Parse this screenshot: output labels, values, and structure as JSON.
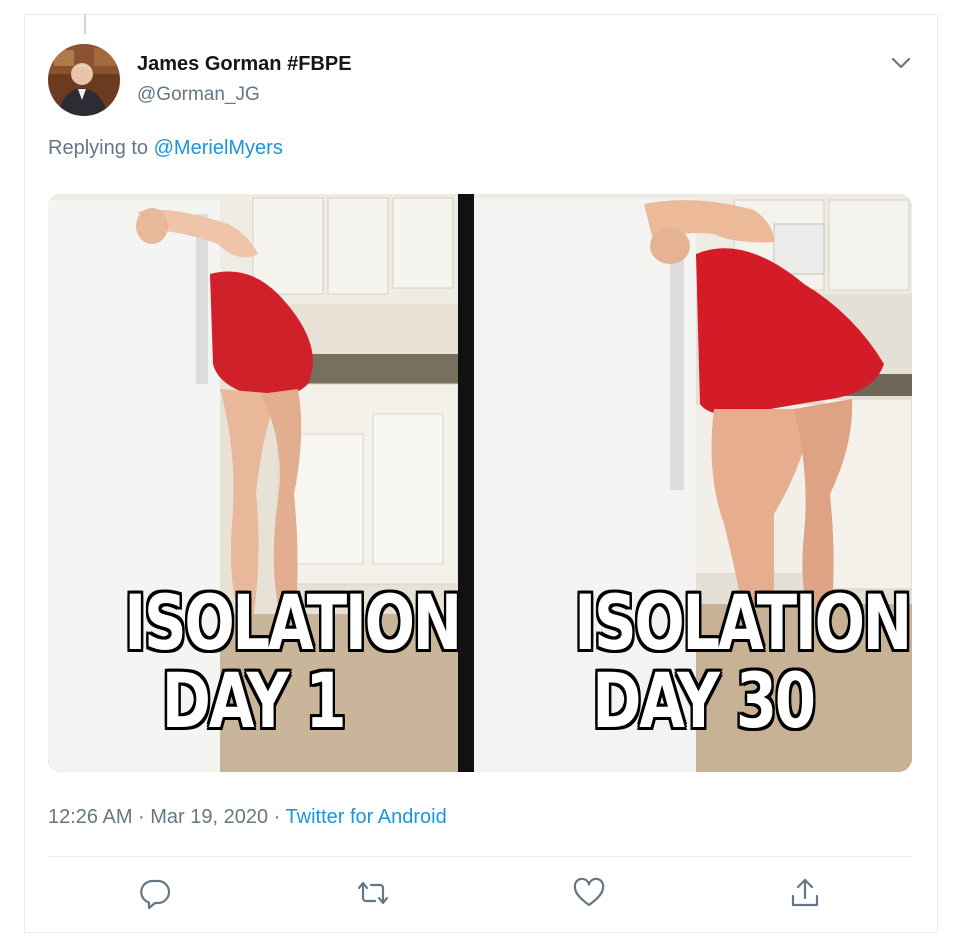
{
  "tweet": {
    "display_name": "James Gorman #FBPE",
    "handle": "@Gorman_JG",
    "replying_prefix": "Replying to ",
    "replying_to": "@MerielMyers",
    "timestamp": "12:26 AM · Mar 19, 2020 · ",
    "source": "Twitter for Android"
  },
  "meme": {
    "left": {
      "line1": "ISOLATION",
      "line2": "DAY 1"
    },
    "right": {
      "line1": "ISOLATION",
      "line2": "DAY 30"
    }
  },
  "actions": {
    "reply_icon": "reply-icon",
    "retweet_icon": "retweet-icon",
    "like_icon": "heart-icon",
    "share_icon": "share-icon"
  },
  "colors": {
    "accent": "#1b95e0",
    "secondary_text": "#657786",
    "primary_text": "#14171a",
    "border": "#e6ecf0"
  }
}
